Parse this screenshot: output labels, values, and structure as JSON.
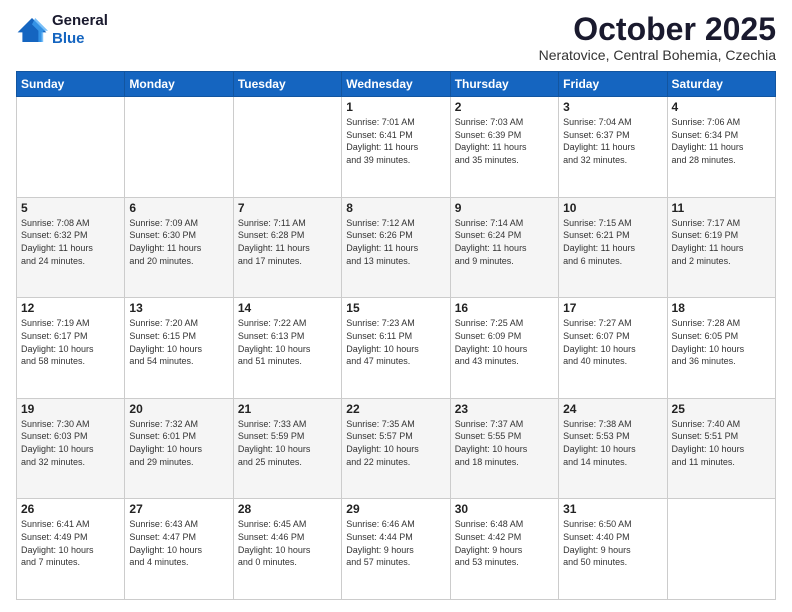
{
  "logo": {
    "line1": "General",
    "line2": "Blue"
  },
  "header": {
    "title": "October 2025",
    "location": "Neratovice, Central Bohemia, Czechia"
  },
  "weekdays": [
    "Sunday",
    "Monday",
    "Tuesday",
    "Wednesday",
    "Thursday",
    "Friday",
    "Saturday"
  ],
  "weeks": [
    [
      {
        "day": "",
        "info": ""
      },
      {
        "day": "",
        "info": ""
      },
      {
        "day": "",
        "info": ""
      },
      {
        "day": "1",
        "info": "Sunrise: 7:01 AM\nSunset: 6:41 PM\nDaylight: 11 hours\nand 39 minutes."
      },
      {
        "day": "2",
        "info": "Sunrise: 7:03 AM\nSunset: 6:39 PM\nDaylight: 11 hours\nand 35 minutes."
      },
      {
        "day": "3",
        "info": "Sunrise: 7:04 AM\nSunset: 6:37 PM\nDaylight: 11 hours\nand 32 minutes."
      },
      {
        "day": "4",
        "info": "Sunrise: 7:06 AM\nSunset: 6:34 PM\nDaylight: 11 hours\nand 28 minutes."
      }
    ],
    [
      {
        "day": "5",
        "info": "Sunrise: 7:08 AM\nSunset: 6:32 PM\nDaylight: 11 hours\nand 24 minutes."
      },
      {
        "day": "6",
        "info": "Sunrise: 7:09 AM\nSunset: 6:30 PM\nDaylight: 11 hours\nand 20 minutes."
      },
      {
        "day": "7",
        "info": "Sunrise: 7:11 AM\nSunset: 6:28 PM\nDaylight: 11 hours\nand 17 minutes."
      },
      {
        "day": "8",
        "info": "Sunrise: 7:12 AM\nSunset: 6:26 PM\nDaylight: 11 hours\nand 13 minutes."
      },
      {
        "day": "9",
        "info": "Sunrise: 7:14 AM\nSunset: 6:24 PM\nDaylight: 11 hours\nand 9 minutes."
      },
      {
        "day": "10",
        "info": "Sunrise: 7:15 AM\nSunset: 6:21 PM\nDaylight: 11 hours\nand 6 minutes."
      },
      {
        "day": "11",
        "info": "Sunrise: 7:17 AM\nSunset: 6:19 PM\nDaylight: 11 hours\nand 2 minutes."
      }
    ],
    [
      {
        "day": "12",
        "info": "Sunrise: 7:19 AM\nSunset: 6:17 PM\nDaylight: 10 hours\nand 58 minutes."
      },
      {
        "day": "13",
        "info": "Sunrise: 7:20 AM\nSunset: 6:15 PM\nDaylight: 10 hours\nand 54 minutes."
      },
      {
        "day": "14",
        "info": "Sunrise: 7:22 AM\nSunset: 6:13 PM\nDaylight: 10 hours\nand 51 minutes."
      },
      {
        "day": "15",
        "info": "Sunrise: 7:23 AM\nSunset: 6:11 PM\nDaylight: 10 hours\nand 47 minutes."
      },
      {
        "day": "16",
        "info": "Sunrise: 7:25 AM\nSunset: 6:09 PM\nDaylight: 10 hours\nand 43 minutes."
      },
      {
        "day": "17",
        "info": "Sunrise: 7:27 AM\nSunset: 6:07 PM\nDaylight: 10 hours\nand 40 minutes."
      },
      {
        "day": "18",
        "info": "Sunrise: 7:28 AM\nSunset: 6:05 PM\nDaylight: 10 hours\nand 36 minutes."
      }
    ],
    [
      {
        "day": "19",
        "info": "Sunrise: 7:30 AM\nSunset: 6:03 PM\nDaylight: 10 hours\nand 32 minutes."
      },
      {
        "day": "20",
        "info": "Sunrise: 7:32 AM\nSunset: 6:01 PM\nDaylight: 10 hours\nand 29 minutes."
      },
      {
        "day": "21",
        "info": "Sunrise: 7:33 AM\nSunset: 5:59 PM\nDaylight: 10 hours\nand 25 minutes."
      },
      {
        "day": "22",
        "info": "Sunrise: 7:35 AM\nSunset: 5:57 PM\nDaylight: 10 hours\nand 22 minutes."
      },
      {
        "day": "23",
        "info": "Sunrise: 7:37 AM\nSunset: 5:55 PM\nDaylight: 10 hours\nand 18 minutes."
      },
      {
        "day": "24",
        "info": "Sunrise: 7:38 AM\nSunset: 5:53 PM\nDaylight: 10 hours\nand 14 minutes."
      },
      {
        "day": "25",
        "info": "Sunrise: 7:40 AM\nSunset: 5:51 PM\nDaylight: 10 hours\nand 11 minutes."
      }
    ],
    [
      {
        "day": "26",
        "info": "Sunrise: 6:41 AM\nSunset: 4:49 PM\nDaylight: 10 hours\nand 7 minutes."
      },
      {
        "day": "27",
        "info": "Sunrise: 6:43 AM\nSunset: 4:47 PM\nDaylight: 10 hours\nand 4 minutes."
      },
      {
        "day": "28",
        "info": "Sunrise: 6:45 AM\nSunset: 4:46 PM\nDaylight: 10 hours\nand 0 minutes."
      },
      {
        "day": "29",
        "info": "Sunrise: 6:46 AM\nSunset: 4:44 PM\nDaylight: 9 hours\nand 57 minutes."
      },
      {
        "day": "30",
        "info": "Sunrise: 6:48 AM\nSunset: 4:42 PM\nDaylight: 9 hours\nand 53 minutes."
      },
      {
        "day": "31",
        "info": "Sunrise: 6:50 AM\nSunset: 4:40 PM\nDaylight: 9 hours\nand 50 minutes."
      },
      {
        "day": "",
        "info": ""
      }
    ]
  ]
}
